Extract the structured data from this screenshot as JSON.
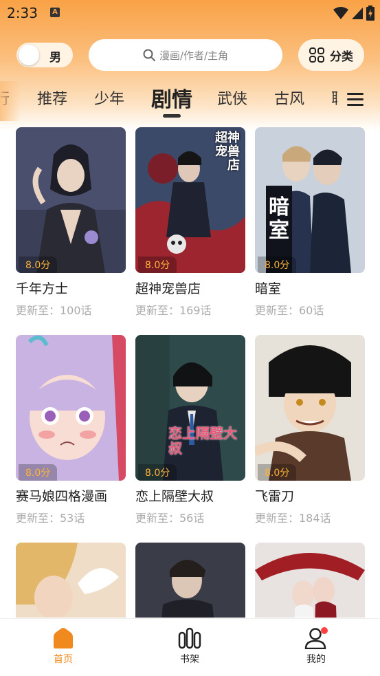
{
  "status_bar": {
    "time": "2:33",
    "app_badge": "A"
  },
  "header": {
    "gender_label": "男",
    "search_placeholder": "漫画/作者/主角",
    "category_label": "分类"
  },
  "tabs": [
    {
      "label": "行"
    },
    {
      "label": "推荐"
    },
    {
      "label": "少年"
    },
    {
      "label": "剧情",
      "active": true
    },
    {
      "label": "武侠"
    },
    {
      "label": "古风"
    },
    {
      "label": "耽"
    }
  ],
  "comics": [
    {
      "title": "千年方士",
      "update": "更新至：100话",
      "score": "8.0分"
    },
    {
      "title": "超神宠兽店",
      "update": "更新至：169话",
      "score": "8.0分",
      "cover_text": "超神宠兽店"
    },
    {
      "title": "暗室",
      "update": "更新至：60话",
      "score": "8.0分",
      "cover_text": "暗室"
    },
    {
      "title": "赛马娘四格漫画",
      "update": "更新至：53话",
      "score": "8.0分"
    },
    {
      "title": "恋上隔壁大叔",
      "update": "更新至：56话",
      "score": "8.0分",
      "cover_text": "恋上隔壁大叔"
    },
    {
      "title": "飞雷刀",
      "update": "更新至：184话",
      "score": "8.0分"
    },
    {
      "title": "",
      "update": "",
      "score": ""
    },
    {
      "title": "",
      "update": "",
      "score": ""
    },
    {
      "title": "",
      "update": "",
      "score": ""
    }
  ],
  "bottom_nav": [
    {
      "label": "首页",
      "icon": "home-icon",
      "active": true
    },
    {
      "label": "书架",
      "icon": "bookshelf-icon"
    },
    {
      "label": "我的",
      "icon": "profile-icon",
      "badge_color": "#ff4040"
    }
  ],
  "colors": {
    "accent": "#f08a1e",
    "score": "#ffb43a",
    "header_gradient_top": "#f9a246"
  }
}
